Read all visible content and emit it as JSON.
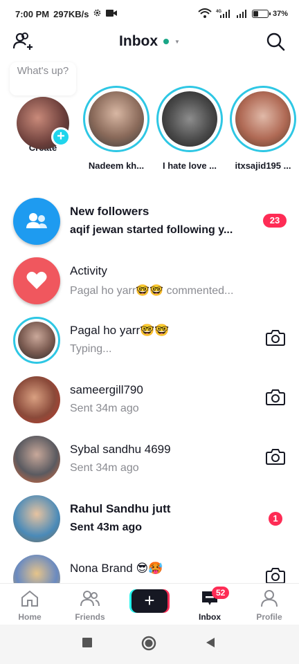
{
  "status_bar": {
    "time": "7:00 PM",
    "speed": "297KB/s",
    "network_label": "4G",
    "battery": "37%",
    "battery_level": 0.37
  },
  "header": {
    "title": "Inbox",
    "add_friends_icon": "add-user-icon",
    "search_icon": "search-icon"
  },
  "stories": {
    "bubble_text": "What's up?",
    "items": [
      {
        "label": "Create"
      },
      {
        "label": "Nadeem kh..."
      },
      {
        "label": "I hate love ..."
      },
      {
        "label": "itxsajid195 ..."
      }
    ]
  },
  "conversations": [
    {
      "name": "New followers",
      "subtitle": "aqif jewan started following y...",
      "badge": "23",
      "icon": "people-icon",
      "color": "#1e9bf0"
    },
    {
      "name": "Activity",
      "subtitle": "Pagal ho yarr🤓🤓 commented...",
      "icon": "heart-icon",
      "color": "#f0575e"
    },
    {
      "name": "Pagal ho yarr🤓🤓",
      "subtitle": "Typing...",
      "action": "camera-icon"
    },
    {
      "name": "sameergill790",
      "subtitle": "Sent 34m ago",
      "action": "camera-icon"
    },
    {
      "name": "Sybal sandhu 4699",
      "subtitle": "Sent 34m ago",
      "action": "camera-icon"
    },
    {
      "name": "Rahul Sandhu jutt",
      "subtitle": "Sent 43m ago",
      "badge": "1"
    },
    {
      "name": "Nona Brand 😎🥵",
      "subtitle": "",
      "action": "camera-icon"
    }
  ],
  "bottom_nav": {
    "items": [
      {
        "label": "Home",
        "icon": "home-icon"
      },
      {
        "label": "Friends",
        "icon": "friends-icon"
      },
      {
        "label": "",
        "icon": "plus-icon"
      },
      {
        "label": "Inbox",
        "icon": "inbox-icon",
        "badge": "52"
      },
      {
        "label": "Profile",
        "icon": "profile-icon"
      }
    ]
  },
  "colors": {
    "accent_cyan": "#2ec7e4",
    "badge_red": "#fe2c55",
    "text_primary": "#161823",
    "text_secondary": "#8a8b91"
  }
}
